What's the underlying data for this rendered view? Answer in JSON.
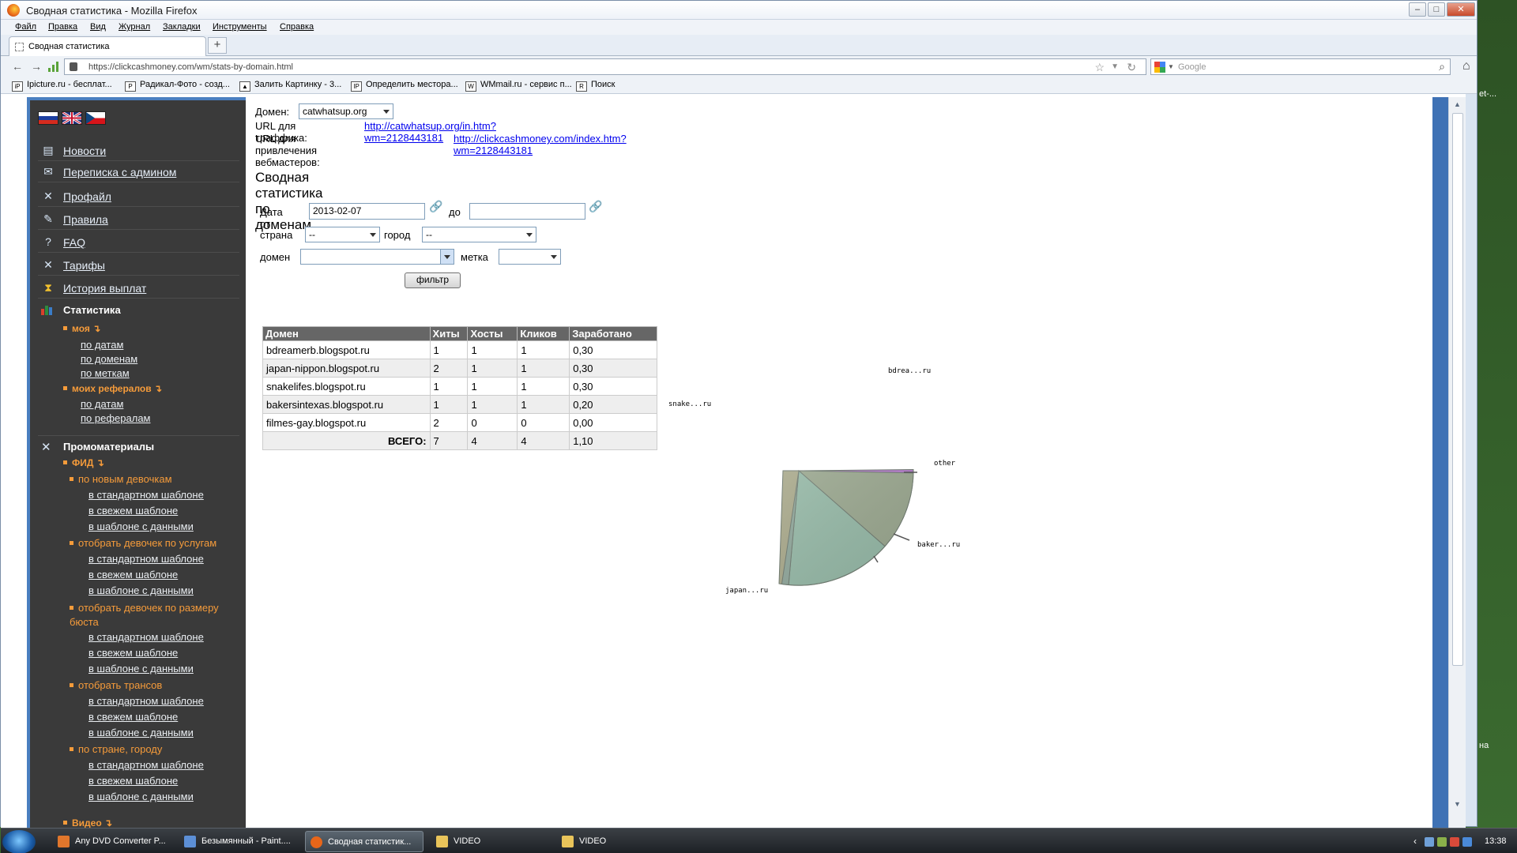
{
  "window": {
    "title": "Сводная статистика - Mozilla Firefox",
    "min": "–",
    "max": "□",
    "close": "✕"
  },
  "menu": [
    "Файл",
    "Правка",
    "Вид",
    "Журнал",
    "Закладки",
    "Инструменты",
    "Справка"
  ],
  "tab": {
    "label": "Сводная статистика",
    "new_tab": "+"
  },
  "nav": {
    "back": "←",
    "forward": "→",
    "url": "https://clickcashmoney.com/wm/stats-by-domain.html",
    "search_placeholder": "Google"
  },
  "bookmarks": [
    {
      "icon": "iP",
      "label": "Ipicture.ru - бесплат..."
    },
    {
      "icon": "Р",
      "label": "Радикал-Фото - созд..."
    },
    {
      "icon": "▲",
      "label": "Залить Картинку - 3..."
    },
    {
      "icon": "IP",
      "label": "Определить местора..."
    },
    {
      "icon": "W",
      "label": "WMmail.ru - сервис п..."
    },
    {
      "icon": "R",
      "label": "Поиск"
    }
  ],
  "sidebar": {
    "menu": [
      {
        "label": "Новости",
        "icon": "news-icon"
      },
      {
        "label": "Переписка с админом",
        "icon": "mail-icon"
      },
      {
        "label": "Профайл",
        "icon": "tools-icon"
      },
      {
        "label": "Правила",
        "icon": "rules-icon"
      },
      {
        "label": "FAQ",
        "icon": "faq-icon"
      },
      {
        "label": "Тарифы",
        "icon": "tools-icon"
      },
      {
        "label": "История выплат",
        "icon": "hourglass-icon"
      }
    ],
    "stats_title": "Статистика",
    "my": "моя",
    "my_links": [
      "по датам",
      "по доменам",
      "по меткам"
    ],
    "referrals": "моих рефералов",
    "ref_links": [
      "по датам",
      "по рефералам"
    ],
    "promo_title": "Промоматериалы",
    "feed": "ФИД",
    "feed_groups": [
      {
        "title": "по новым девочкам",
        "links": [
          "в стандартном шаблоне",
          "в свежем шаблоне",
          "в шаблоне с данными"
        ]
      },
      {
        "title": "отобрать девочек по услугам",
        "links": [
          "в стандартном шаблоне",
          "в свежем шаблоне",
          "в шаблоне с данными"
        ]
      },
      {
        "title": "отобрать девочек по размеру бюста",
        "links": [
          "в стандартном шаблоне",
          "в свежем шаблоне",
          "в шаблоне с данными"
        ]
      },
      {
        "title": "отобрать трансов",
        "links": [
          "в стандартном шаблоне",
          "в свежем шаблоне",
          "в шаблоне с данными"
        ]
      },
      {
        "title": "по стране, городу",
        "links": [
          "в стандартном шаблоне",
          "в свежем шаблоне",
          "в шаблоне с данными"
        ]
      }
    ],
    "video": "Видео"
  },
  "main": {
    "domain_label": "Домен:",
    "domain_value": "catwhatsup.org",
    "traffic_url_label": "URL для траффика:",
    "traffic_url": "http://catwhatsup.org/in.htm?wm=2128443181",
    "webmaster_url_label": "URL для привлечения вебмастеров:",
    "webmaster_url": "http://clickcashmoney.com/index.htm?wm=2128443181",
    "heading": "Сводная статистика по доменам",
    "filter": {
      "date_from_label": "Дата от",
      "date_from": "2013-02-07",
      "date_to_label": "до",
      "date_to": "",
      "country_label": "страна",
      "country_value": "--",
      "city_label": "город",
      "city_value": "--",
      "domain_label": "домен",
      "tag_label": "метка",
      "submit": "фильтр"
    },
    "table": {
      "headers": [
        "Домен",
        "Хиты",
        "Хосты",
        "Кликов",
        "Заработано"
      ],
      "rows": [
        [
          "bdreamerb.blogspot.ru",
          "1",
          "1",
          "1",
          "0,30"
        ],
        [
          "japan-nippon.blogspot.ru",
          "2",
          "1",
          "1",
          "0,30"
        ],
        [
          "snakelifes.blogspot.ru",
          "1",
          "1",
          "1",
          "0,30"
        ],
        [
          "bakersintexas.blogspot.ru",
          "1",
          "1",
          "1",
          "0,20"
        ],
        [
          "filmes-gay.blogspot.ru",
          "2",
          "0",
          "0",
          "0,00"
        ]
      ],
      "total_label": "ВСЕГО:",
      "totals": [
        "7",
        "4",
        "4",
        "1,10"
      ]
    }
  },
  "chart_data": {
    "type": "pie",
    "slices": [
      {
        "label": "bdrea...ru",
        "value": 0.3,
        "color": "#8fa69a"
      },
      {
        "label": "japan...ru",
        "value": 0.3,
        "color": "#95b8a6"
      },
      {
        "label": "snake...ru",
        "value": 0.3,
        "color": "#a9a98c"
      },
      {
        "label": "baker...ru",
        "value": 0.2,
        "color": "#9aa78f"
      },
      {
        "label": "other",
        "value": 0.005,
        "color": "#b27bc8"
      }
    ]
  },
  "taskbar": {
    "items": [
      {
        "label": "Any DVD Converter P...",
        "color": "#e0762c"
      },
      {
        "label": "Безымянный - Paint....",
        "color": "#5c8fd6"
      },
      {
        "label": "Сводная статистик...",
        "color": "#e8661a"
      },
      {
        "label": "VIDEO",
        "color": "#e9c45a"
      },
      {
        "label": "VIDEO",
        "color": "#e9c45a"
      }
    ],
    "clock": "13:38"
  },
  "desktop_right": {
    "text1": "et-...",
    "text2": "на"
  }
}
